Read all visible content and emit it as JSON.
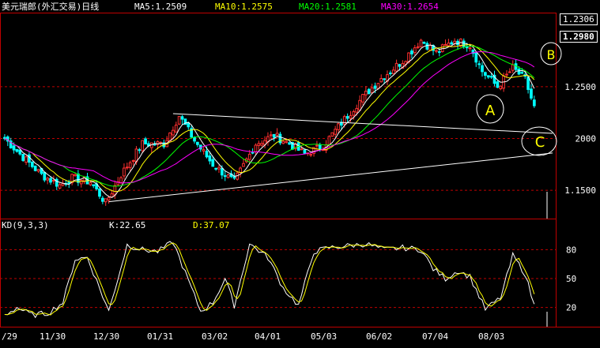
{
  "header": {
    "title": "美元瑞郎(外汇交易)日线",
    "ma_labels": [
      {
        "text": "MA5:1.2509",
        "color": "#ffffff"
      },
      {
        "text": "MA10:1.2575",
        "color": "#ffff00"
      },
      {
        "text": "MA20:1.2581",
        "color": "#00ff00"
      },
      {
        "text": "MA30:1.2654",
        "color": "#ff00ff"
      }
    ]
  },
  "kd_header": {
    "title": "KD(9,3,3)",
    "k": "K:22.65",
    "d": "D:37.07"
  },
  "price_axis": {
    "ticks": [
      1.15,
      1.2,
      1.25
    ],
    "tick_labels": [
      "1.1500",
      "2000",
      "1.2500"
    ],
    "ylim": [
      1.125,
      1.32
    ],
    "high_marker": "1.2306",
    "current_marker": "1.2980"
  },
  "kd_axis": {
    "ticks": [
      20,
      50,
      80
    ],
    "tick_labels": [
      "20",
      "50",
      "80"
    ],
    "ylim": [
      0,
      100
    ]
  },
  "x_axis": {
    "labels": [
      "/29",
      "11/30",
      "12/30",
      "01/31",
      "03/02",
      "04/01",
      "05/03",
      "06/02",
      "07/04",
      "08/03"
    ]
  },
  "annotations": [
    "A",
    "B",
    "C"
  ],
  "colors": {
    "background": "#000000",
    "bull": "#ff3030",
    "bear": "#00ffff",
    "ma5": "#ffffff",
    "ma10": "#ffff00",
    "ma20": "#00ff00",
    "ma30": "#ff00ff",
    "grid": "#c00000",
    "axis": "#c00000",
    "k_line": "#ffffff",
    "d_line": "#ffff00"
  },
  "chart_data": [
    {
      "type": "candlestick",
      "title": "美元瑞郎(外汇交易)日线",
      "ylim": [
        1.125,
        1.32
      ],
      "x_labels": [
        "/29",
        "11/30",
        "12/30",
        "01/31",
        "03/02",
        "04/01",
        "05/03",
        "06/02",
        "07/04",
        "08/03"
      ],
      "close_keypoints": [
        {
          "bar": 0,
          "close": 1.2
        },
        {
          "bar": 5,
          "close": 1.185
        },
        {
          "bar": 12,
          "close": 1.165
        },
        {
          "bar": 18,
          "close": 1.155
        },
        {
          "bar": 22,
          "close": 1.162
        },
        {
          "bar": 28,
          "close": 1.158
        },
        {
          "bar": 33,
          "close": 1.138
        },
        {
          "bar": 38,
          "close": 1.165
        },
        {
          "bar": 45,
          "close": 1.195
        },
        {
          "bar": 52,
          "close": 1.195
        },
        {
          "bar": 57,
          "close": 1.222
        },
        {
          "bar": 62,
          "close": 1.198
        },
        {
          "bar": 68,
          "close": 1.175
        },
        {
          "bar": 75,
          "close": 1.158
        },
        {
          "bar": 82,
          "close": 1.195
        },
        {
          "bar": 88,
          "close": 1.203
        },
        {
          "bar": 93,
          "close": 1.195
        },
        {
          "bar": 98,
          "close": 1.185
        },
        {
          "bar": 104,
          "close": 1.193
        },
        {
          "bar": 110,
          "close": 1.215
        },
        {
          "bar": 117,
          "close": 1.24
        },
        {
          "bar": 123,
          "close": 1.258
        },
        {
          "bar": 130,
          "close": 1.275
        },
        {
          "bar": 136,
          "close": 1.295
        },
        {
          "bar": 141,
          "close": 1.283
        },
        {
          "bar": 147,
          "close": 1.295
        },
        {
          "bar": 152,
          "close": 1.29
        },
        {
          "bar": 156,
          "close": 1.265
        },
        {
          "bar": 161,
          "close": 1.25
        },
        {
          "bar": 166,
          "close": 1.268
        },
        {
          "bar": 170,
          "close": 1.257
        },
        {
          "bar": 173,
          "close": 1.23
        }
      ],
      "trendlines": [
        {
          "from": {
            "bar": 34,
            "price": 1.139
          },
          "to": {
            "bar": 179,
            "price": 1.186
          }
        },
        {
          "from": {
            "bar": 55,
            "price": 1.224
          },
          "to": {
            "bar": 179,
            "price": 1.205
          }
        }
      ],
      "ma": {
        "MA5": 1.2509,
        "MA10": 1.2575,
        "MA20": 1.2581,
        "MA30": 1.2654
      }
    },
    {
      "type": "line",
      "title": "KD(9,3,3)",
      "ylim": [
        0,
        100
      ],
      "k_keypoints": [
        {
          "bar": 0,
          "v": 12
        },
        {
          "bar": 4,
          "v": 20
        },
        {
          "bar": 9,
          "v": 12
        },
        {
          "bar": 14,
          "v": 14
        },
        {
          "bar": 19,
          "v": 25
        },
        {
          "bar": 23,
          "v": 70
        },
        {
          "bar": 27,
          "v": 72
        },
        {
          "bar": 31,
          "v": 40
        },
        {
          "bar": 34,
          "v": 16
        },
        {
          "bar": 40,
          "v": 85
        },
        {
          "bar": 45,
          "v": 80
        },
        {
          "bar": 50,
          "v": 78
        },
        {
          "bar": 55,
          "v": 88
        },
        {
          "bar": 60,
          "v": 48
        },
        {
          "bar": 64,
          "v": 16
        },
        {
          "bar": 68,
          "v": 25
        },
        {
          "bar": 72,
          "v": 50
        },
        {
          "bar": 75,
          "v": 22
        },
        {
          "bar": 80,
          "v": 86
        },
        {
          "bar": 86,
          "v": 72
        },
        {
          "bar": 91,
          "v": 40
        },
        {
          "bar": 96,
          "v": 22
        },
        {
          "bar": 101,
          "v": 78
        },
        {
          "bar": 106,
          "v": 82
        },
        {
          "bar": 112,
          "v": 84
        },
        {
          "bar": 118,
          "v": 86
        },
        {
          "bar": 124,
          "v": 80
        },
        {
          "bar": 130,
          "v": 82
        },
        {
          "bar": 136,
          "v": 80
        },
        {
          "bar": 140,
          "v": 60
        },
        {
          "bar": 144,
          "v": 50
        },
        {
          "bar": 148,
          "v": 58
        },
        {
          "bar": 152,
          "v": 52
        },
        {
          "bar": 157,
          "v": 18
        },
        {
          "bar": 162,
          "v": 30
        },
        {
          "bar": 166,
          "v": 74
        },
        {
          "bar": 170,
          "v": 55
        },
        {
          "bar": 173,
          "v": 22
        }
      ],
      "k": 22.65,
      "d": 37.07
    }
  ]
}
